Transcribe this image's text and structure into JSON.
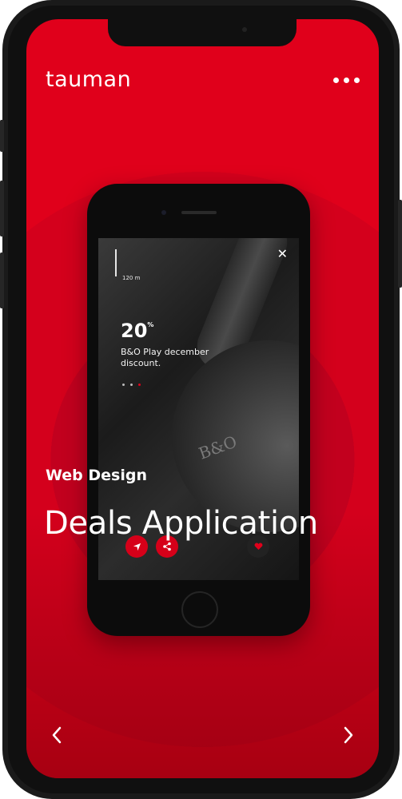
{
  "app": {
    "logo": "tauman",
    "menu_icon": "more-dots-icon"
  },
  "slide": {
    "category": "Web Design",
    "title": "Deals Application",
    "prev_icon": "chevron-left-icon",
    "next_icon": "chevron-right-icon"
  },
  "preview": {
    "distance": "120 m",
    "discount_value": "20",
    "discount_unit": "%",
    "description": "B&O Play december discount.",
    "close_icon": "close-icon",
    "actions": [
      "navigate-icon",
      "share-icon",
      "heart-icon"
    ]
  },
  "colors": {
    "brand_red": "#e0001b",
    "dark_red": "#c2001e",
    "frame": "#101010"
  }
}
